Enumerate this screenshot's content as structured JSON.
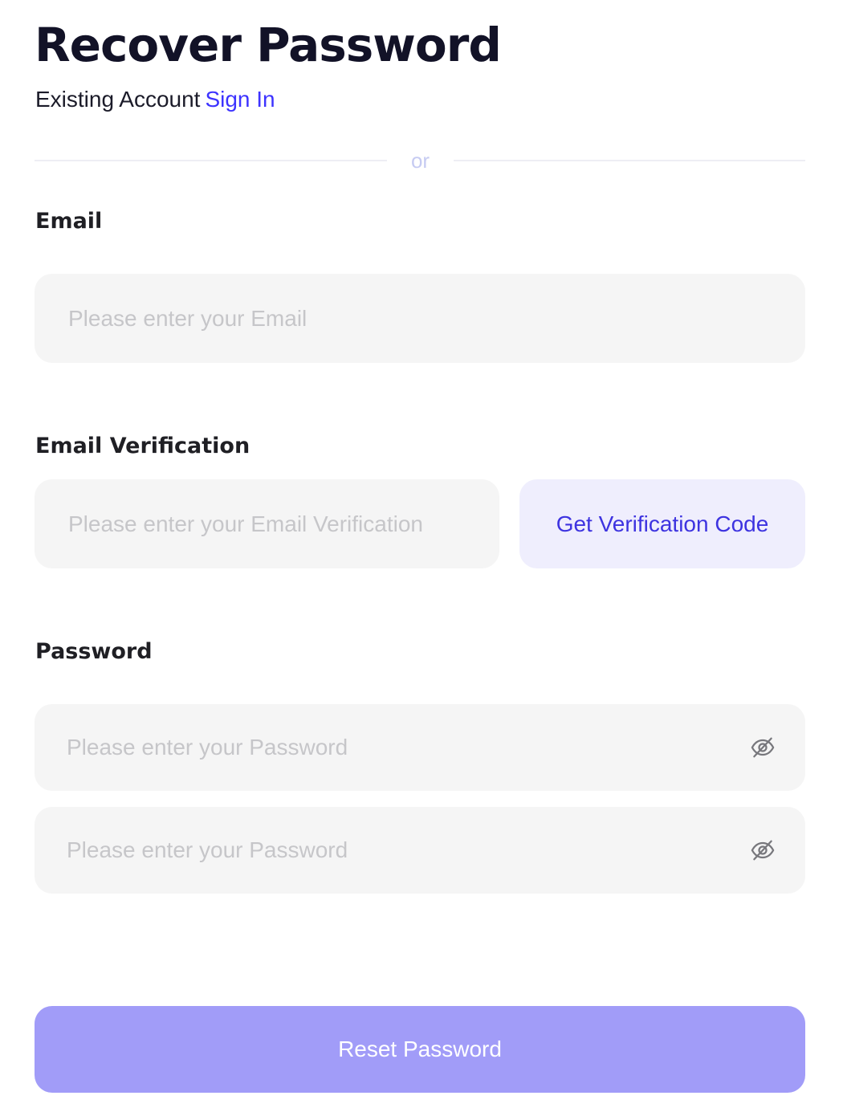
{
  "page": {
    "title": "Recover Password",
    "existing_account_text": "Existing Account",
    "sign_in_link": "Sign In",
    "divider_text": "or"
  },
  "form": {
    "email": {
      "label": "Email",
      "placeholder": "Please enter your Email",
      "value": ""
    },
    "verification": {
      "label": "Email Verification",
      "placeholder": "Please enter your Email Verification",
      "value": "",
      "button_label": "Get Verification Code"
    },
    "password": {
      "label": "Password",
      "placeholder": "Please enter your Password",
      "value": "",
      "toggle_icon": "eye-off-icon"
    },
    "confirm_password": {
      "placeholder": "Please enter your Password",
      "value": "",
      "toggle_icon": "eye-off-icon"
    },
    "submit_label": "Reset Password"
  },
  "colors": {
    "accent": "#3d33ff",
    "submit_button_bg": "#a19cf8",
    "code_button_bg": "#efeefd",
    "field_bg": "#f5f5f5"
  }
}
